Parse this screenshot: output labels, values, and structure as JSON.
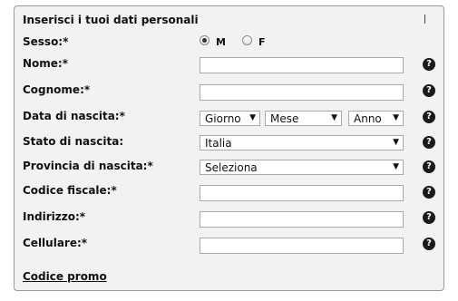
{
  "form": {
    "title": "Inserisci i tuoi dati personali",
    "title_mark": "I",
    "sex": {
      "label": "Sesso:*",
      "options": [
        {
          "label": "M",
          "checked": true
        },
        {
          "label": "F",
          "checked": false
        }
      ]
    },
    "name": {
      "label": "Nome:*",
      "value": ""
    },
    "surname": {
      "label": "Cognome:*",
      "value": ""
    },
    "birth_date": {
      "label": "Data di nascita:*",
      "day": "Giorno",
      "month": "Mese",
      "year": "Anno"
    },
    "birth_country": {
      "label": "Stato di nascita:",
      "value": "Italia"
    },
    "birth_province": {
      "label": "Provincia di nascita:*",
      "value": "Seleziona"
    },
    "tax_code": {
      "label": "Codice fiscale:*",
      "value": ""
    },
    "address": {
      "label": "Indirizzo:*",
      "value": ""
    },
    "mobile": {
      "label": "Cellulare:*",
      "value": ""
    },
    "promo_link": "Codice promo",
    "help_glyph": "?",
    "arrow_glyph": "▼"
  },
  "icons": {
    "help": "help-icon",
    "dropdown": "chevron-down-icon"
  },
  "colors": {
    "panel_background": "#f2f2f2",
    "panel_border": "#9a9a9a",
    "help_icon": "#1a1a1a",
    "text": "#111111"
  }
}
